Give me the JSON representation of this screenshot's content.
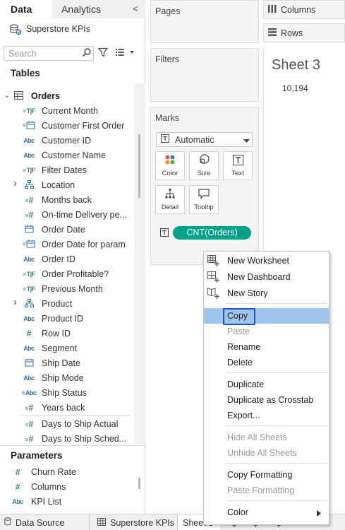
{
  "left_pane": {
    "tabs": [
      "Data",
      "Analytics"
    ],
    "collapse_glyph": "<",
    "datasource": "Superstore KPIs",
    "search_placeholder": "Search",
    "tables_heading": "Tables",
    "table_name": "Orders",
    "fields": [
      {
        "label": "Current Month",
        "icon": "=T|F"
      },
      {
        "label": "Customer First Order",
        "icon": "=cal"
      },
      {
        "label": "Customer ID",
        "icon": "Abc"
      },
      {
        "label": "Customer Name",
        "icon": "Abc"
      },
      {
        "label": "Filter Dates",
        "icon": "=T|F"
      },
      {
        "label": "Location",
        "icon": "hierarchy"
      },
      {
        "label": "Months back",
        "icon": "=#"
      },
      {
        "label": "On-time Delivery pe...",
        "icon": "=#"
      },
      {
        "label": "Order Date",
        "icon": "cal"
      },
      {
        "label": "Order Date for param",
        "icon": "=cal"
      },
      {
        "label": "Order ID",
        "icon": "Abc"
      },
      {
        "label": "Order Profitable?",
        "icon": "=T|F"
      },
      {
        "label": "Previous Month",
        "icon": "=T|F"
      },
      {
        "label": "Product",
        "icon": "hierarchy"
      },
      {
        "label": "Product ID",
        "icon": "Abc"
      },
      {
        "label": "Row ID",
        "icon": "#"
      },
      {
        "label": "Segment",
        "icon": "Abc"
      },
      {
        "label": "Ship Date",
        "icon": "cal"
      },
      {
        "label": "Ship Mode",
        "icon": "Abc"
      },
      {
        "label": "Ship Status",
        "icon": "=Abc"
      },
      {
        "label": "Years back",
        "icon": "=#"
      },
      {
        "label": "Days to Ship Actual",
        "icon": "=#"
      },
      {
        "label": "Days to Ship Sched...",
        "icon": "=#"
      }
    ],
    "parameters_heading": "Parameters",
    "parameters": [
      {
        "label": "Churn Rate",
        "icon": "#"
      },
      {
        "label": "Columns",
        "icon": "#"
      },
      {
        "label": "KPI List",
        "icon": "Abc"
      }
    ]
  },
  "shelves": {
    "pages": "Pages",
    "filters": "Filters",
    "marks": "Marks",
    "mark_type": "Automatic",
    "mark_buttons": [
      "Color",
      "Size",
      "Text",
      "Detail",
      "Tooltip"
    ],
    "pill": "CNT(Orders)",
    "columns": "Columns",
    "rows": "Rows"
  },
  "canvas": {
    "sheet_title": "Sheet 3",
    "value": "10,194"
  },
  "bottom_tabs": {
    "data_source": "Data Source",
    "tab1": "Superstore KPIs",
    "tab2": "Sheet 3"
  },
  "context_menu": {
    "items": [
      {
        "label": "New Worksheet",
        "icon": "new-worksheet-icon",
        "enabled": true
      },
      {
        "label": "New Dashboard",
        "icon": "new-dashboard-icon",
        "enabled": true
      },
      {
        "label": "New Story",
        "icon": "new-story-icon",
        "enabled": true
      },
      {
        "label": "Copy",
        "enabled": true,
        "selected": true
      },
      {
        "label": "Paste",
        "enabled": false
      },
      {
        "label": "Rename",
        "enabled": true
      },
      {
        "label": "Delete",
        "enabled": true
      },
      {
        "label": "Duplicate",
        "enabled": true
      },
      {
        "label": "Duplicate as Crosstab",
        "enabled": true
      },
      {
        "label": "Export...",
        "enabled": true
      },
      {
        "label": "Hide All Sheets",
        "enabled": false
      },
      {
        "label": "Unhide All Sheets",
        "enabled": false
      },
      {
        "label": "Copy Formatting",
        "enabled": true
      },
      {
        "label": "Paste Formatting",
        "enabled": false
      },
      {
        "label": "Color",
        "enabled": true,
        "submenu": true
      }
    ]
  },
  "colors": {
    "pill_green": "#00a38a",
    "selection_blue": "#9fc6ea",
    "focus_outline": "#1b56d2",
    "field_icon_teal": "#3a7f7a",
    "field_icon_blue": "#2d6fb4"
  }
}
